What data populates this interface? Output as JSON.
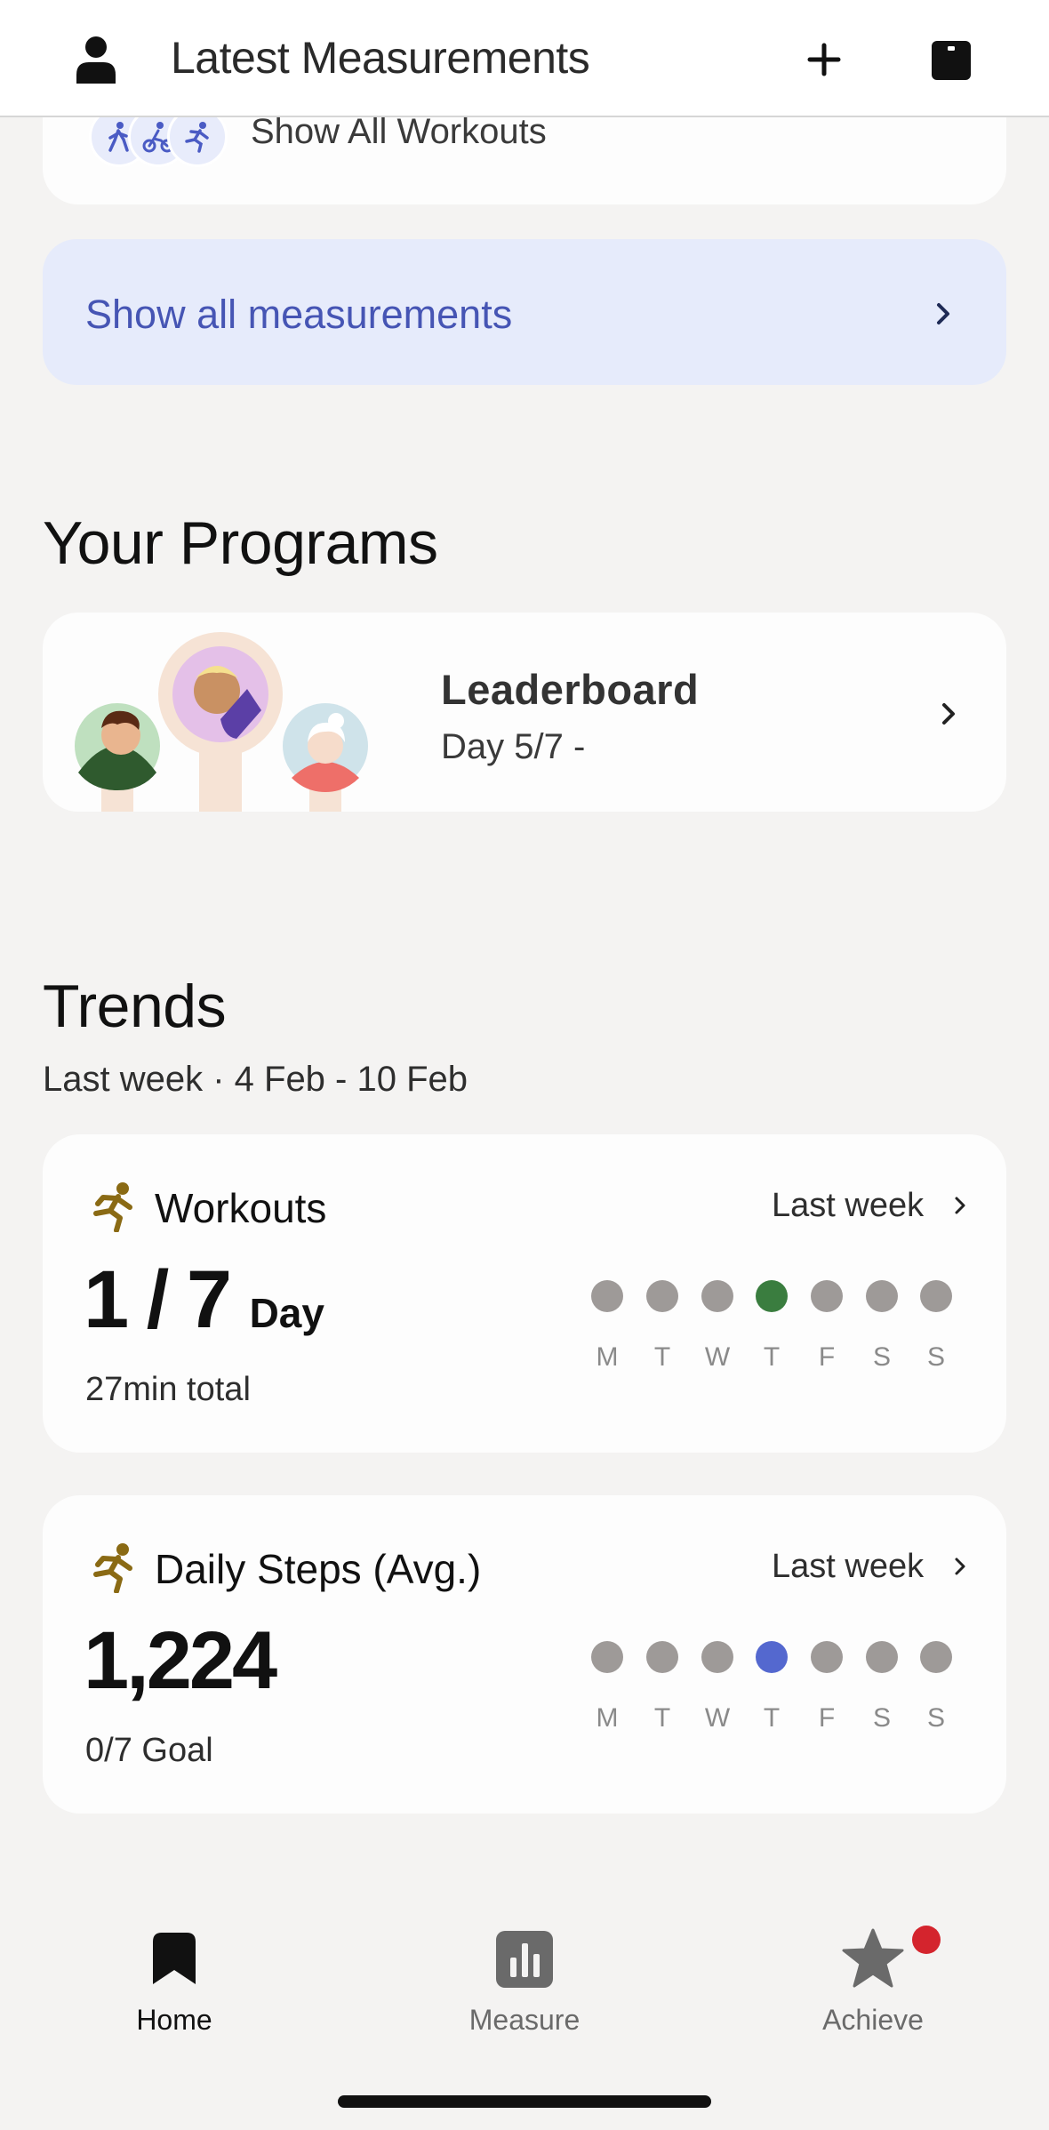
{
  "header": {
    "title": "Latest Measurements",
    "icons": [
      "person-icon",
      "plus-icon",
      "device-icon"
    ]
  },
  "workouts_strip": {
    "label": "Show All Workouts",
    "icons": [
      "walk-icon",
      "bike-icon",
      "run-icon"
    ]
  },
  "measurements_button": {
    "label": "Show all measurements"
  },
  "programs": {
    "section_title": "Your Programs",
    "card": {
      "title": "Leaderboard",
      "subtitle": "Day 5/7 -"
    }
  },
  "trends": {
    "section_title": "Trends",
    "subtitle": "Last week · 4 Feb - 10 Feb",
    "cards": [
      {
        "title": "Workouts",
        "link": "Last week",
        "value": "1 / 7",
        "unit": "Day",
        "footer": "27min total",
        "days": [
          "M",
          "T",
          "W",
          "T",
          "F",
          "S",
          "S"
        ],
        "highlight_index": 3,
        "highlight_color": "#3a7d3f"
      },
      {
        "title": "Daily Steps (Avg.)",
        "link": "Last week",
        "value": "1,224",
        "footer": "0/7 Goal",
        "days": [
          "M",
          "T",
          "W",
          "T",
          "F",
          "S",
          "S"
        ],
        "highlight_index": 3,
        "highlight_color": "#5468cf"
      }
    ]
  },
  "nav": {
    "items": [
      {
        "label": "Home",
        "icon": "bookmark-icon",
        "active": true
      },
      {
        "label": "Measure",
        "icon": "bar-chart-icon",
        "active": false
      },
      {
        "label": "Achieve",
        "icon": "star-icon",
        "active": false
      }
    ]
  },
  "colors": {
    "accent": "#4655b4",
    "accent_bg": "#e6ebfb",
    "inactive_dot": "#9e9a98",
    "notification": "#d4242d"
  }
}
